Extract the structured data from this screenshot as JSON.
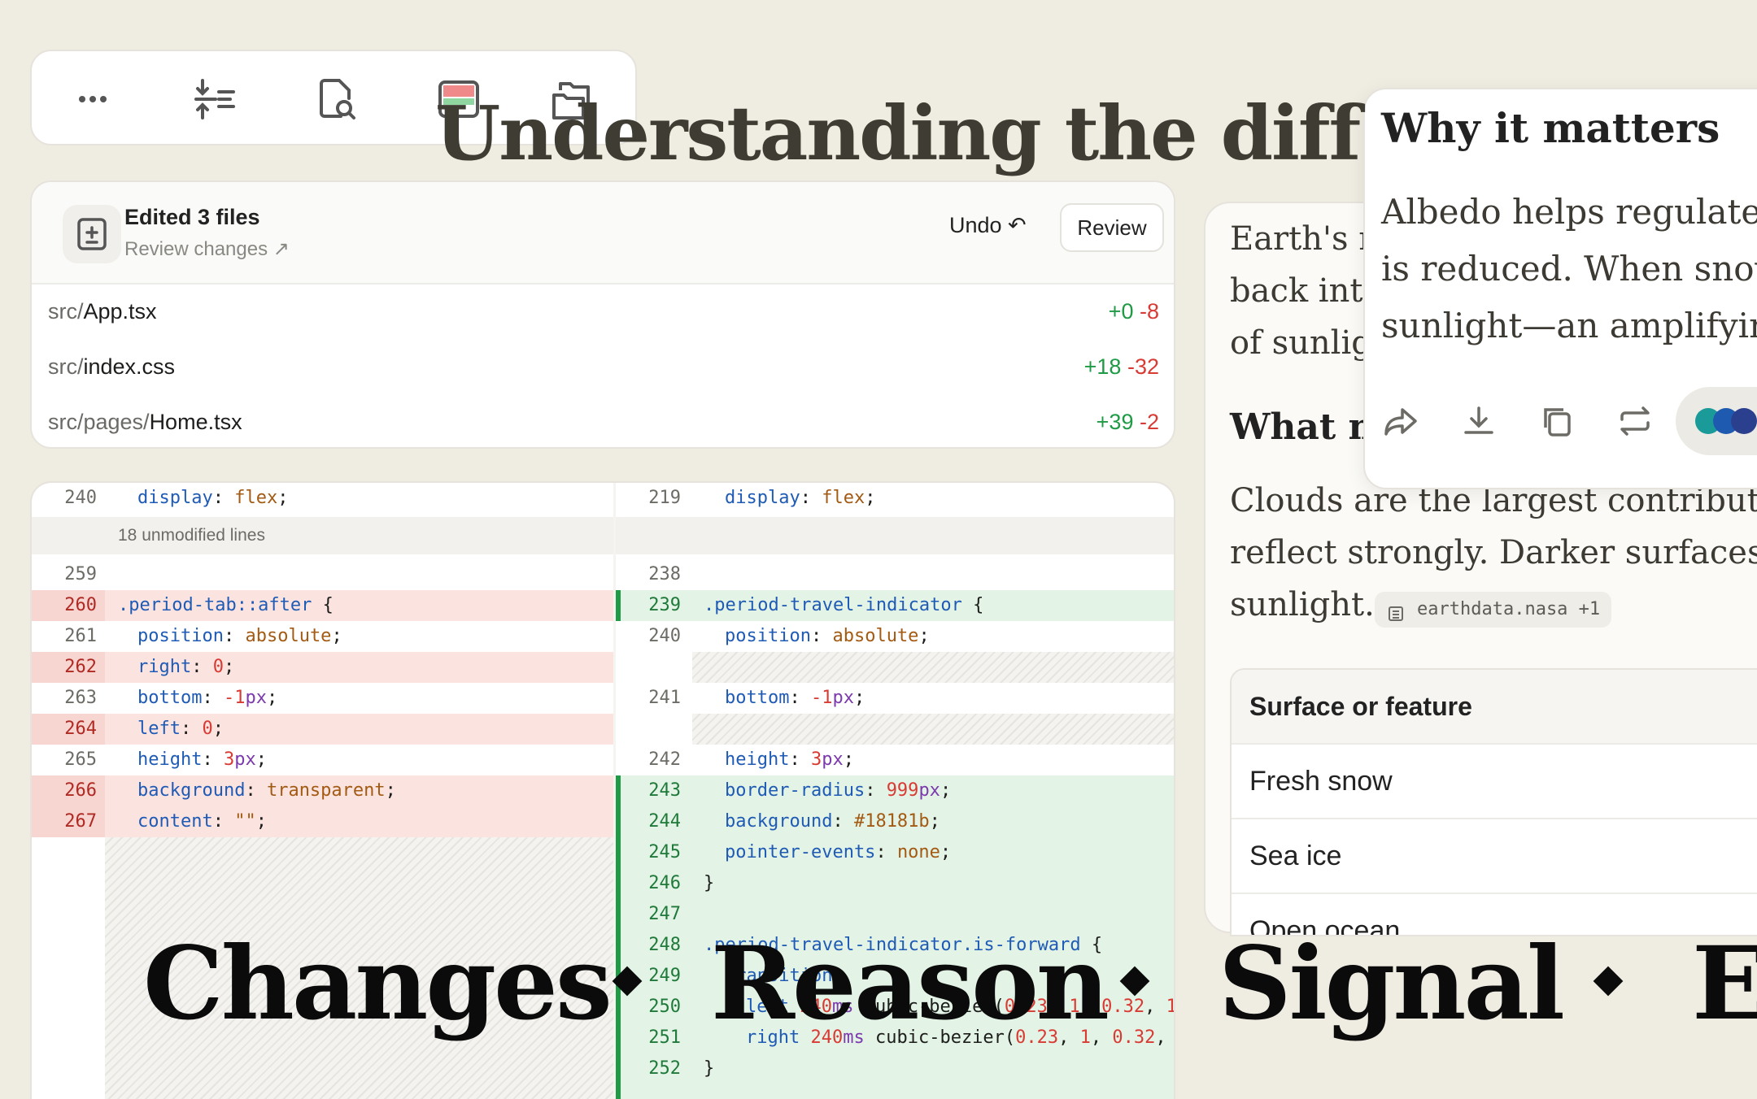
{
  "page_title": "Understanding the diff",
  "toolbar": {
    "icons": [
      "more-icon",
      "collapse-lines-icon",
      "search-file-icon",
      "diff-view-icon",
      "copy-folders-icon"
    ]
  },
  "files_card": {
    "title": "Edited 3 files",
    "review_link": "Review changes ↗",
    "undo_label": "Undo ↶",
    "review_label": "Review",
    "files": [
      {
        "dir": "src/",
        "name": "App.tsx",
        "added": "+0",
        "removed": "-8"
      },
      {
        "dir": "src/",
        "name": "index.css",
        "added": "+18",
        "removed": "-32"
      },
      {
        "dir": "src/pages/",
        "name": "Home.tsx",
        "added": "+39",
        "removed": "-2"
      }
    ]
  },
  "diff": {
    "unmodified_label": "18 unmodified lines",
    "left_numbers": [
      "240",
      "259",
      "260",
      "261",
      "262",
      "263",
      "264",
      "265",
      "266",
      "267"
    ],
    "right_numbers": [
      "219",
      "238",
      "239",
      "240",
      "241",
      "242",
      "243",
      "244",
      "245",
      "246",
      "247",
      "248",
      "249",
      "250",
      "251",
      "252"
    ]
  },
  "article": {
    "line1": "Earth's re",
    "line2": "back into",
    "line3": "of sunlig",
    "heading": "What m",
    "line4": "Clouds are the largest contributor t",
    "line5": "reflect strongly. Darker surfaces—e",
    "line6": "sunlight.",
    "source": "earthdata.nasa +1",
    "table_header": "Surface or feature",
    "rows": [
      "Fresh snow",
      "Sea ice",
      "Open ocean"
    ]
  },
  "popup": {
    "title": "Why it matters",
    "line1": "Albedo helps regulate c",
    "line2": "is reduced. When snow",
    "line3": "sunlight—an amplifyin",
    "icons": [
      "share-icon",
      "download-icon",
      "copy-icon",
      "repeat-icon"
    ]
  },
  "banner": {
    "words": [
      "Changes",
      "Reason",
      "Signal",
      "E"
    ]
  }
}
